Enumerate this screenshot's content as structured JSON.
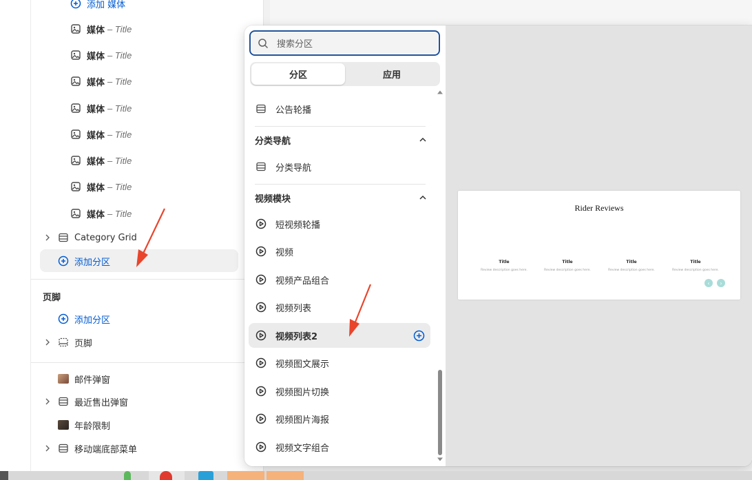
{
  "sidebar": {
    "top_add_label": "添加 媒体",
    "media_items": [
      {
        "label": "媒体",
        "sub": "– Title"
      },
      {
        "label": "媒体",
        "sub": "– Title"
      },
      {
        "label": "媒体",
        "sub": "– Title"
      },
      {
        "label": "媒体",
        "sub": "– Title"
      },
      {
        "label": "媒体",
        "sub": "– Title"
      },
      {
        "label": "媒体",
        "sub": "– Title"
      },
      {
        "label": "媒体",
        "sub": "– Title"
      },
      {
        "label": "媒体",
        "sub": "– Title"
      }
    ],
    "category_grid": "Category Grid",
    "add_section": "添加分区",
    "footer_heading": "页脚",
    "footer_add_section": "添加分区",
    "footer_item": "页脚",
    "popups": [
      {
        "label": "邮件弹窗"
      },
      {
        "label": "最近售出弹窗"
      },
      {
        "label": "年龄限制"
      },
      {
        "label": "移动端底部菜单"
      }
    ]
  },
  "picker": {
    "search_placeholder": "搜索分区",
    "tabs": [
      {
        "label": "分区",
        "active": true
      },
      {
        "label": "应用",
        "active": false
      }
    ],
    "top_item": "公告轮播",
    "groups": [
      {
        "heading": "分类导航",
        "items": [
          "分类导航"
        ]
      },
      {
        "heading": "视频模块",
        "items": [
          "短视频轮播",
          "视频",
          "视频产品组合",
          "视频列表",
          "视频列表2",
          "视频图文展示",
          "视频图片切换",
          "视频图片海报",
          "视频文字组合"
        ]
      }
    ],
    "hovered_item": "视频列表2"
  },
  "preview": {
    "title": "Rider Reviews",
    "reviews": [
      {
        "title": "Title",
        "desc": "Review description goes here."
      },
      {
        "title": "Title",
        "desc": "Review description goes here."
      },
      {
        "title": "Title",
        "desc": "Review description goes here."
      },
      {
        "title": "Title",
        "desc": "Review description goes here."
      }
    ],
    "nav_prev": "‹",
    "nav_next": "›"
  },
  "colors": {
    "accent": "#005bd3",
    "search_border": "#1f5199",
    "annotation_arrow": "#e8452c",
    "preview_nav": "#a8dcd9"
  }
}
